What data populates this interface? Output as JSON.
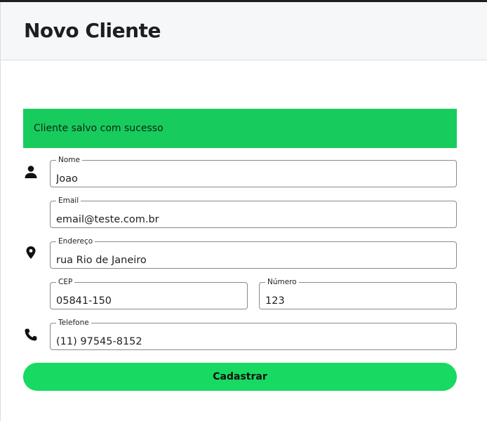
{
  "header": {
    "title": "Novo Cliente"
  },
  "alert": {
    "message": "Cliente salvo com sucesso",
    "color": "#17cc5d"
  },
  "form": {
    "nome": {
      "label": "Nome",
      "value": "Joao"
    },
    "email": {
      "label": "Email",
      "value": "email@teste.com.br"
    },
    "endereco": {
      "label": "Endereço",
      "value": "rua Rio de Janeiro"
    },
    "cep": {
      "label": "CEP",
      "value": "05841-150"
    },
    "numero": {
      "label": "Número",
      "value": "123"
    },
    "telefone": {
      "label": "Telefone",
      "value": "(11) 97545-8152"
    }
  },
  "icons": [
    "person-icon",
    "location-pin-icon",
    "phone-icon"
  ],
  "submit": {
    "label": "Cadastrar",
    "color": "#18d962"
  }
}
